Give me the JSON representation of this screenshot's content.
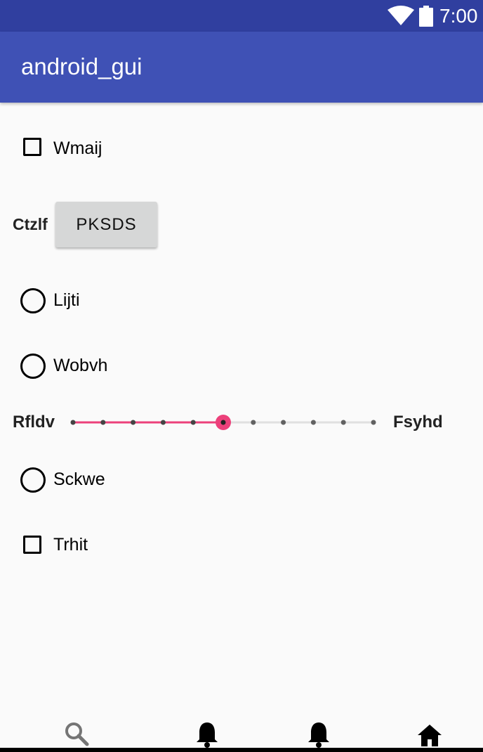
{
  "status_bar": {
    "time": "7:00",
    "icons": [
      "wifi-icon",
      "battery-icon"
    ]
  },
  "app_bar": {
    "title": "android_gui"
  },
  "content": {
    "checkbox1": {
      "label": "Wmaij",
      "checked": false
    },
    "button_row": {
      "label": "Ctzlf",
      "button_text": "PKSDS"
    },
    "radio1": {
      "label": "Lijti",
      "selected": false
    },
    "radio2": {
      "label": "Wobvh",
      "selected": false
    },
    "slider": {
      "start_label": "Rfldv",
      "end_label": "Fsyhd",
      "steps": 10,
      "value": 5,
      "accent_color": "#ec407a"
    },
    "radio3": {
      "label": "Sckwe",
      "selected": false
    },
    "checkbox2": {
      "label": "Trhit",
      "checked": false
    }
  },
  "bottom_nav": {
    "items": [
      "search-icon",
      "bell-icon",
      "bell-icon",
      "home-icon"
    ]
  }
}
